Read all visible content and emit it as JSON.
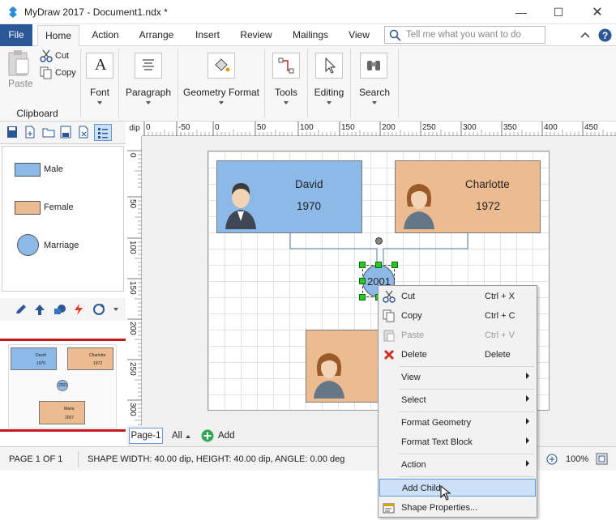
{
  "window": {
    "title": "MyDraw 2017 - Document1.ndx *"
  },
  "menu": {
    "file": "File",
    "tabs": [
      "Home",
      "Action",
      "Arrange",
      "Insert",
      "Review",
      "Mailings",
      "View"
    ],
    "search_placeholder": "Tell me what you want to do"
  },
  "ribbon": {
    "paste": "Paste",
    "cut": "Cut",
    "copy": "Copy",
    "clipboard": "Clipboard",
    "font": "Font",
    "paragraph": "Paragraph",
    "geometry_format": "Geometry Format",
    "tools": "Tools",
    "editing": "Editing",
    "search": "Search"
  },
  "shapes_panel": {
    "items": [
      "Male",
      "Female",
      "Marriage"
    ]
  },
  "ruler": {
    "unit": "dip",
    "top_ticks": [
      "0",
      "-50",
      "0",
      "50",
      "100",
      "150",
      "200",
      "250",
      "300",
      "350",
      "400",
      "450"
    ],
    "left_ticks": [
      "0",
      "50",
      "100",
      "150",
      "200",
      "250",
      "300"
    ]
  },
  "diagram": {
    "male": {
      "name": "David",
      "year": "1970"
    },
    "female": {
      "name": "Charlotte",
      "year": "1972"
    },
    "marriage": {
      "year": "2001"
    }
  },
  "preview": {
    "male": "David",
    "male_year": "1970",
    "female": "Charlotte",
    "female_year": "1972",
    "child": "Maria",
    "child_year": "2007",
    "marriage": "2001"
  },
  "pagetabs": {
    "page": "Page-1",
    "all": "All",
    "add": "Add"
  },
  "status": {
    "page": "PAGE 1 OF 1",
    "shape": "SHAPE WIDTH: 40.00 dip, HEIGHT: 40.00 dip, ANGLE: 0.00 deg",
    "zoom": "100%"
  },
  "context_menu": {
    "cut": "Cut",
    "cut_sc": "Ctrl + X",
    "copy": "Copy",
    "copy_sc": "Ctrl + C",
    "paste": "Paste",
    "paste_sc": "Ctrl + V",
    "delete": "Delete",
    "delete_sc": "Delete",
    "view": "View",
    "select": "Select",
    "format_geometry": "Format Geometry",
    "format_text": "Format Text Block",
    "action": "Action",
    "add_child": "Add Child",
    "shape_properties": "Shape Properties..."
  },
  "colors": {
    "male": "#8cb9e8",
    "female": "#edbb90",
    "file_tab": "#2b5797",
    "accent_red": "#c9191e"
  }
}
